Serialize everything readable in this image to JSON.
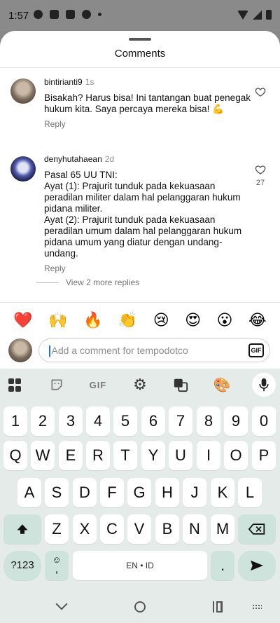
{
  "status_bar": {
    "time": "1:57"
  },
  "sheet": {
    "title": "Comments"
  },
  "comments": [
    {
      "username": "bintirianti9",
      "time": "1s",
      "text": "Bisakah? Harus bisa! Ini tantangan buat penegak hukum kita. Saya percaya mereka bisa! 💪",
      "reply_label": "Reply",
      "likes": ""
    },
    {
      "username": "denyhutahaean",
      "time": "2d",
      "text": "Pasal 65 UU TNI:\nAyat (1): Prajurit tunduk pada kekuasaan peradilan militer dalam hal pelanggaran hukum pidana militer.\nAyat (2): Prajurit tunduk pada kekuasaan peradilan umum dalam hal pelanggaran hukum pidana umum yang diatur dengan undang-undang.",
      "reply_label": "Reply",
      "likes": "27"
    }
  ],
  "view_more_replies": "View 2 more replies",
  "emojis": [
    "❤️",
    "🙌",
    "🔥",
    "👏",
    "😢",
    "😍",
    "😮",
    "😂"
  ],
  "comment_input": {
    "placeholder": "Add a comment for tempodotco",
    "gif_label": "GIF"
  },
  "keyboard": {
    "toolbar_gif": "GIF",
    "rows": [
      [
        "1",
        "2",
        "3",
        "4",
        "5",
        "6",
        "7",
        "8",
        "9",
        "0"
      ],
      [
        "Q",
        "W",
        "E",
        "R",
        "T",
        "Y",
        "U",
        "I",
        "O",
        "P"
      ],
      [
        "A",
        "S",
        "D",
        "F",
        "G",
        "H",
        "J",
        "K",
        "L"
      ],
      [
        "Z",
        "X",
        "C",
        "V",
        "B",
        "N",
        "M"
      ]
    ],
    "sym_label": "?123",
    "comma_label": ",",
    "space_label": "EN • ID",
    "period_label": "."
  },
  "icons": {
    "heart": "heart-icon",
    "shift": "shift-icon",
    "backspace": "backspace-icon",
    "enter": "send-arrow-icon",
    "mic": "mic-icon"
  }
}
